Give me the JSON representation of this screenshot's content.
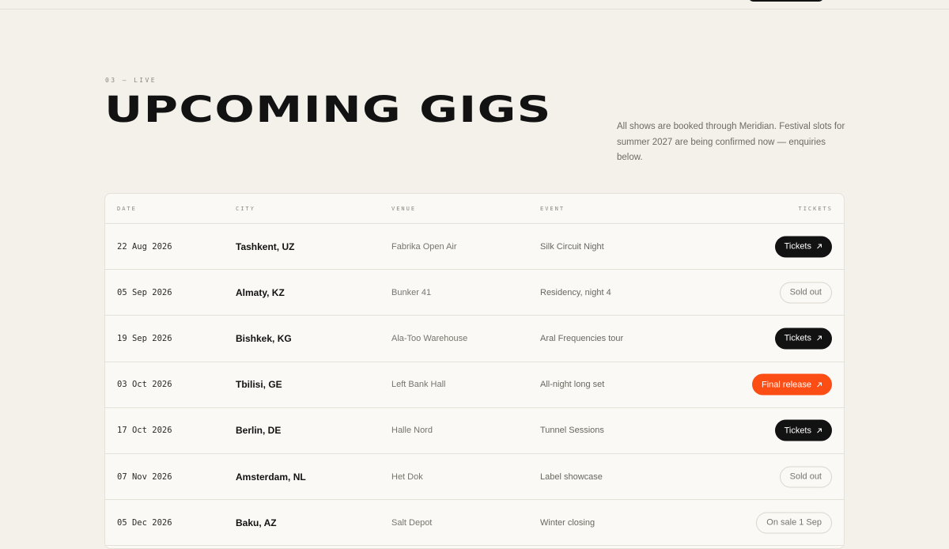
{
  "colors": {
    "background": "#f3f1ea",
    "ink": "#121212",
    "accent": "#fc4d14",
    "muted": "#77746c"
  },
  "section": {
    "eyebrow": "03 — LIVE",
    "title": "UPCOMING GIGS",
    "intro": "All shows are booked through Meridian. Festival slots for summer 2027 are being confirmed now — enquiries below."
  },
  "table": {
    "headers": {
      "date": "DATE",
      "city": "CITY",
      "venue": "VENUE",
      "event": "EVENT",
      "tickets": "TICKETS"
    },
    "rows": [
      {
        "date": "22 Aug 2026",
        "city": "Tashkent, UZ",
        "venue": "Fabrika Open Air",
        "event": "Silk Circuit Night",
        "action": "Tickets",
        "style": "dark",
        "icon": "arrow-up-right-icon"
      },
      {
        "date": "05 Sep 2026",
        "city": "Almaty, KZ",
        "venue": "Bunker 41",
        "event": "Residency, night 4",
        "action": "Sold out",
        "style": "outline"
      },
      {
        "date": "19 Sep 2026",
        "city": "Bishkek, KG",
        "venue": "Ala-Too Warehouse",
        "event": "Aral Frequencies tour",
        "action": "Tickets",
        "style": "dark",
        "icon": "arrow-up-right-icon"
      },
      {
        "date": "03 Oct 2026",
        "city": "Tbilisi, GE",
        "venue": "Left Bank Hall",
        "event": "All-night long set",
        "action": "Final release",
        "style": "orange",
        "icon": "arrow-up-right-icon"
      },
      {
        "date": "17 Oct 2026",
        "city": "Berlin, DE",
        "venue": "Halle Nord",
        "event": "Tunnel Sessions",
        "action": "Tickets",
        "style": "dark",
        "icon": "arrow-up-right-icon"
      },
      {
        "date": "07 Nov 2026",
        "city": "Amsterdam, NL",
        "venue": "Het Dok",
        "event": "Label showcase",
        "action": "Sold out",
        "style": "outline"
      },
      {
        "date": "05 Dec 2026",
        "city": "Baku, AZ",
        "venue": "Salt Depot",
        "event": "Winter closing",
        "action": "On sale 1 Sep",
        "style": "outline"
      }
    ]
  }
}
